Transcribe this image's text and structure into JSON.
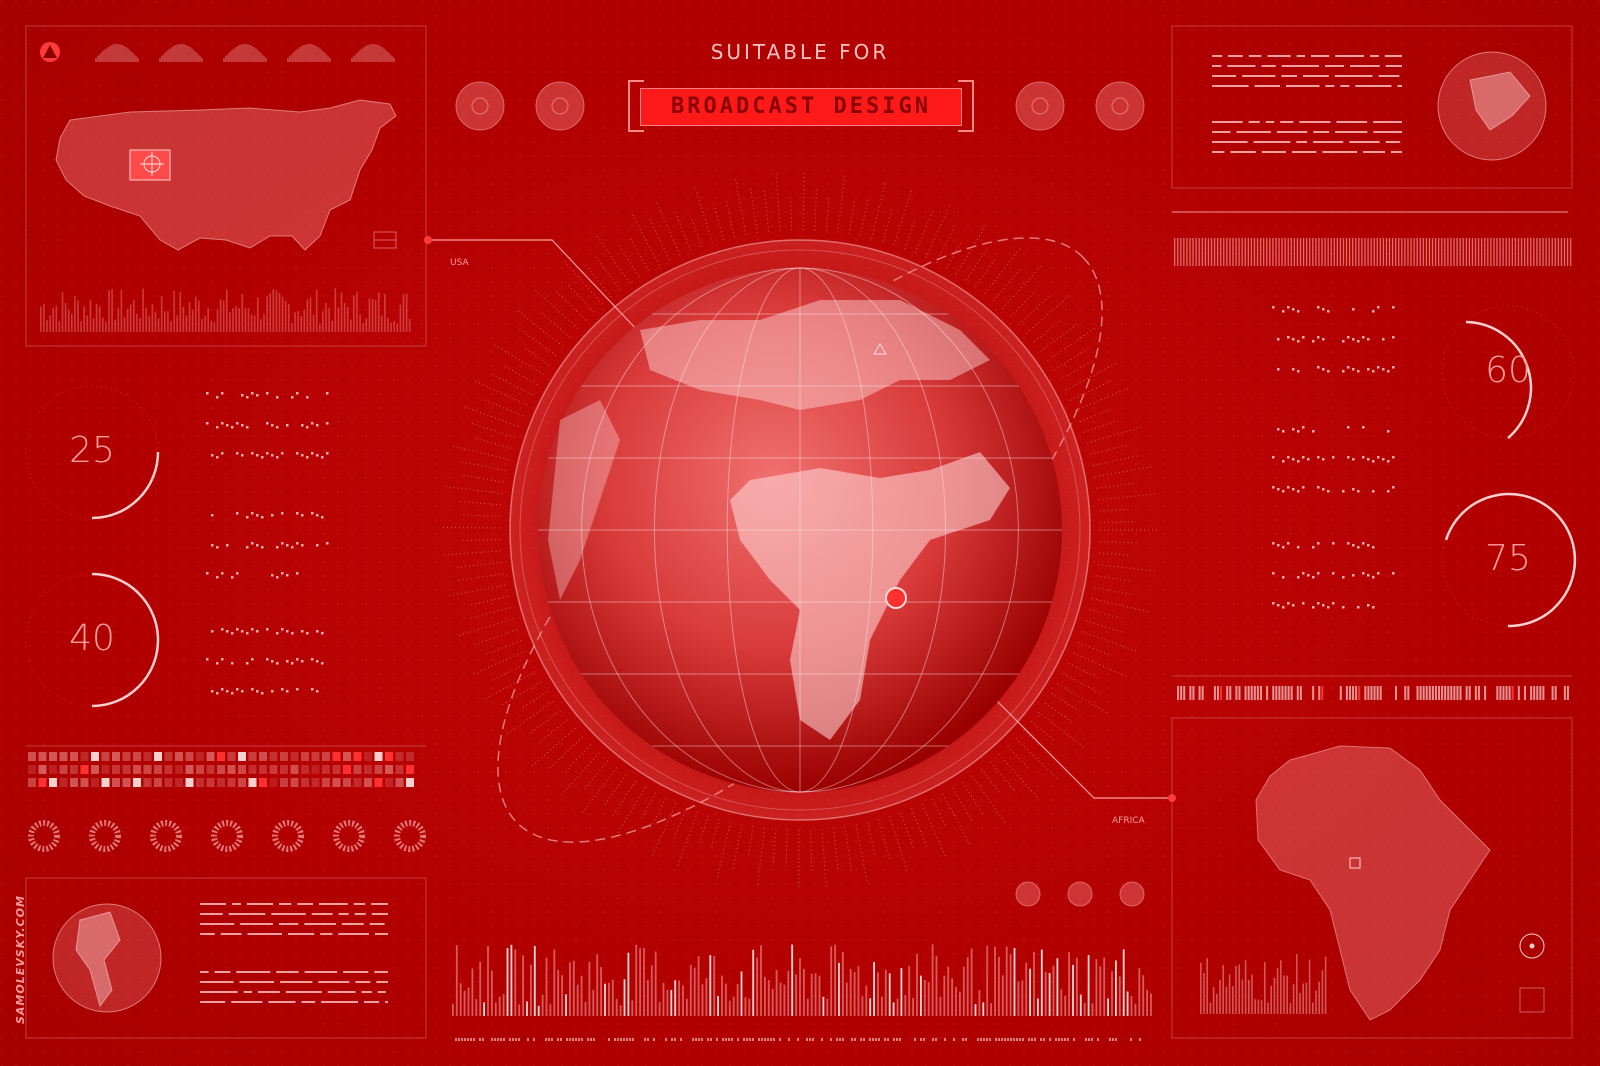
{
  "header": {
    "subtitle": "SUITABLE FOR",
    "badge": "BROADCAST DESIGN"
  },
  "gauges": {
    "left_top": "25",
    "left_bottom": "40",
    "right_top": "60",
    "right_bottom": "75"
  },
  "labels": {
    "usa": "USA",
    "africa": "AFRICA"
  },
  "watermark": "SAMOLEVSKY.COM",
  "colors": {
    "background": "#b30000",
    "accent": "#ff1a1a",
    "line": "#ff9e9e"
  }
}
